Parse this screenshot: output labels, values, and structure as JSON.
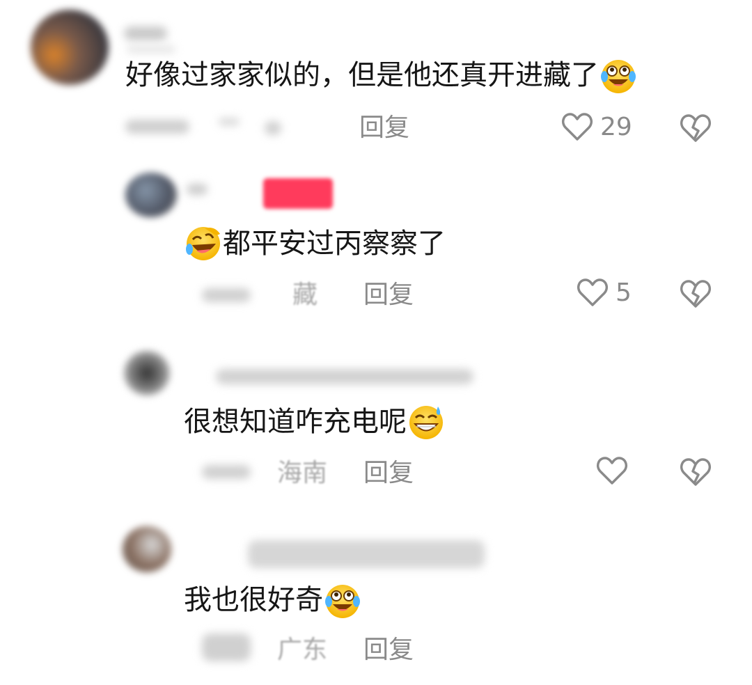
{
  "comments": [
    {
      "text": "好像过家家似的，但是他还真开进藏了",
      "emoji": "crying-laughing-face",
      "reply_label": "回复",
      "like_count": "29"
    },
    {
      "text": "都平安过丙察察了",
      "emoji": "rolling-laughing-face",
      "location": "藏",
      "reply_label": "回复",
      "like_count": "5"
    },
    {
      "text": "很想知道咋充电呢",
      "emoji": "grinning-sweat-face",
      "location": "海南",
      "reply_label": "回复",
      "like_count": ""
    },
    {
      "text": "我也很好奇",
      "emoji": "crying-laughing-face",
      "location": "广东",
      "reply_label": "回复"
    }
  ],
  "colors": {
    "text": "#161616",
    "meta": "#8a8a8a",
    "badge": "#ff3b5c"
  }
}
